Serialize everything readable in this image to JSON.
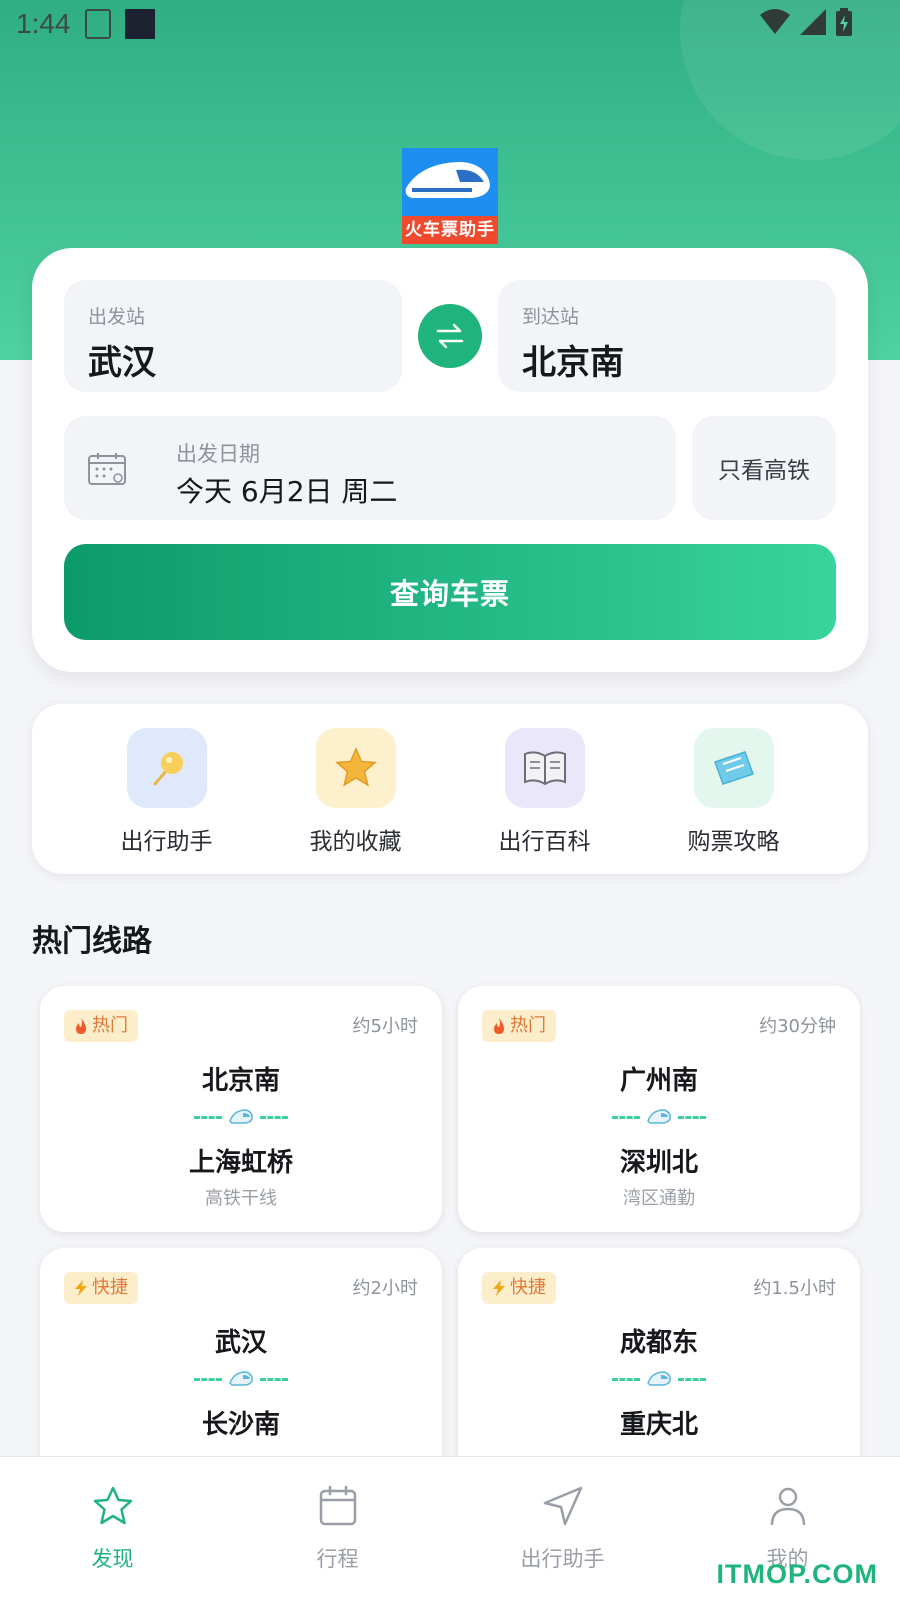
{
  "status_bar": {
    "time": "1:44"
  },
  "logo": {
    "text": "火车票助手"
  },
  "search": {
    "from_label": "出发站",
    "from_value": "武汉",
    "to_label": "到达站",
    "to_value": "北京南",
    "date_label": "出发日期",
    "date_value": "今天 6月2日 周二",
    "high_speed_only": "只看高铁",
    "query_button": "查询车票"
  },
  "quick_actions": [
    {
      "label": "出行助手",
      "icon": "pin-icon",
      "bg": "#dfe9fb"
    },
    {
      "label": "我的收藏",
      "icon": "star-icon",
      "bg": "#fdf0cc"
    },
    {
      "label": "出行百科",
      "icon": "book-icon",
      "bg": "#ebe7fb"
    },
    {
      "label": "购票攻略",
      "icon": "ticket-icon",
      "bg": "#e3f7ef"
    }
  ],
  "hot_routes": {
    "title": "热门线路",
    "routes": [
      {
        "tag": "热门",
        "tag_icon": "fire-icon",
        "duration": "约5小时",
        "from": "北京南",
        "to": "上海虹桥",
        "desc": "高铁干线"
      },
      {
        "tag": "热门",
        "tag_icon": "fire-icon",
        "duration": "约30分钟",
        "from": "广州南",
        "to": "深圳北",
        "desc": "湾区通勤"
      },
      {
        "tag": "快捷",
        "tag_icon": "lightning-icon",
        "duration": "约2小时",
        "from": "武汉",
        "to": "长沙南",
        "desc": ""
      },
      {
        "tag": "快捷",
        "tag_icon": "lightning-icon",
        "duration": "约1.5小时",
        "from": "成都东",
        "to": "重庆北",
        "desc": ""
      }
    ]
  },
  "tabbar": [
    {
      "label": "发现",
      "icon": "star-icon",
      "active": true
    },
    {
      "label": "行程",
      "icon": "calendar-icon",
      "active": false
    },
    {
      "label": "出行助手",
      "icon": "navigation-icon",
      "active": false
    },
    {
      "label": "我的",
      "icon": "user-icon",
      "active": false
    }
  ],
  "watermark": "ITMOP.COM",
  "colors": {
    "primary": "#1fb47d",
    "hero_top": "#2fae83",
    "hero_bottom": "#4fd1a1",
    "tag_text": "#e0783a"
  }
}
